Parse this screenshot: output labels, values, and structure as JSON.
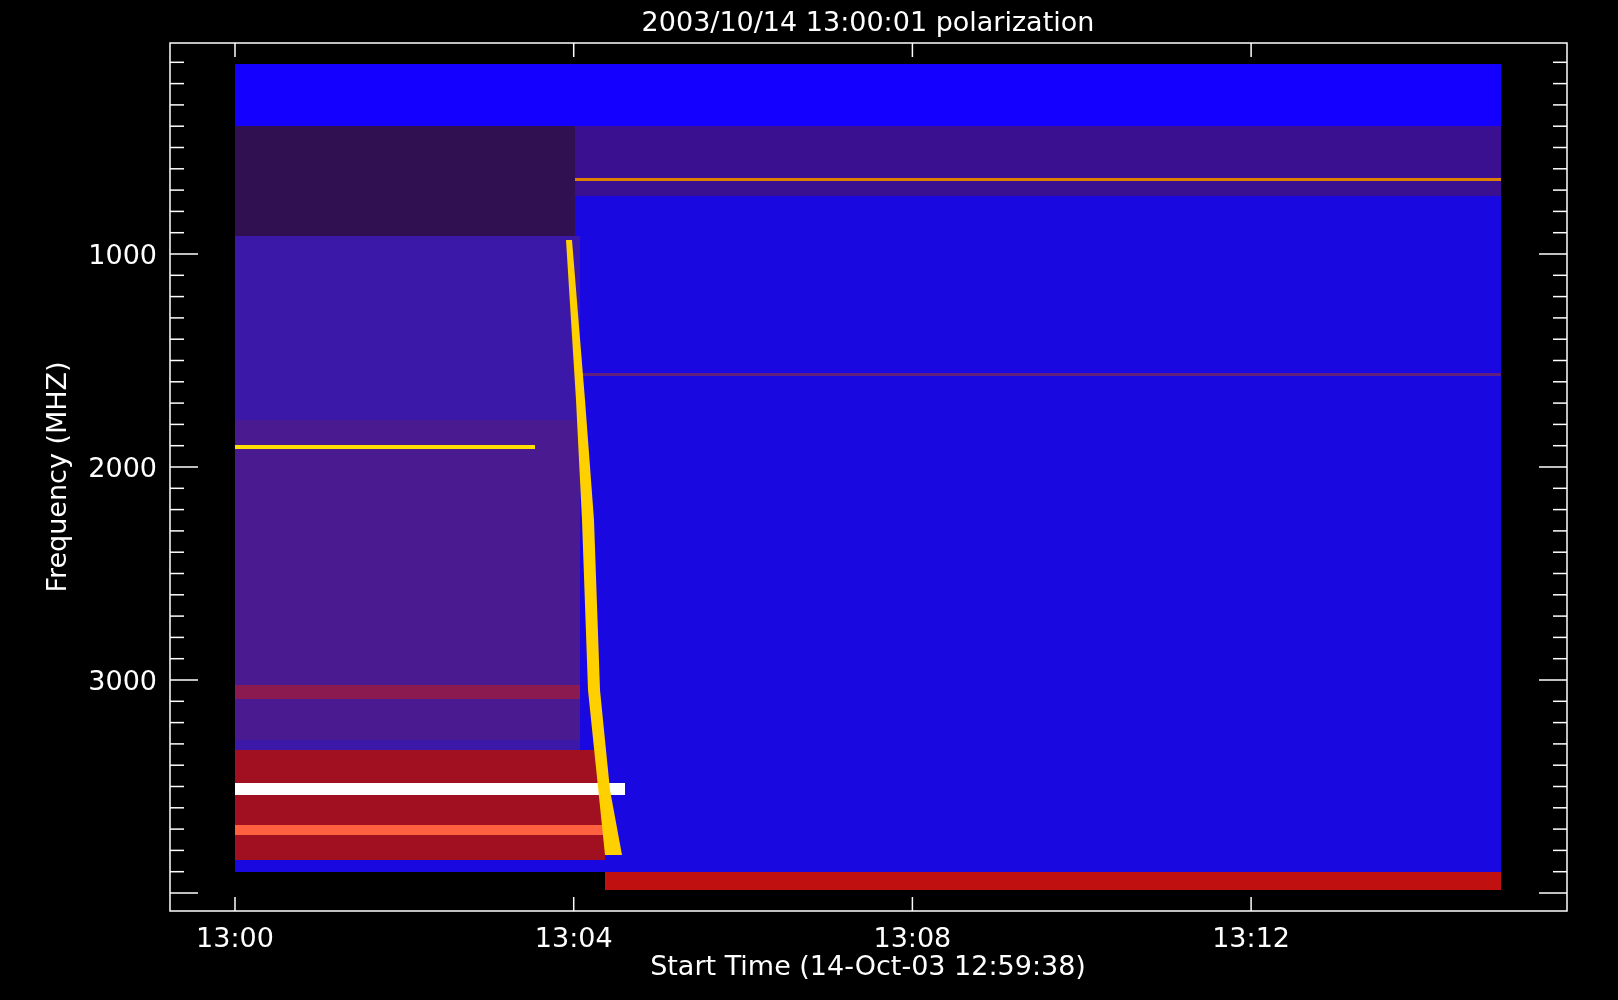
{
  "title": "2003/10/14 13:00:01 polarization",
  "plot": {
    "xlabel": "Start Time (14-Oct-03 12:59:38)",
    "ylabel": "Frequency (MHZ)",
    "xticks": [
      "13:00",
      "13:04",
      "13:08",
      "13:12"
    ],
    "yticks": [
      "1000",
      "2000",
      "3000"
    ]
  }
}
